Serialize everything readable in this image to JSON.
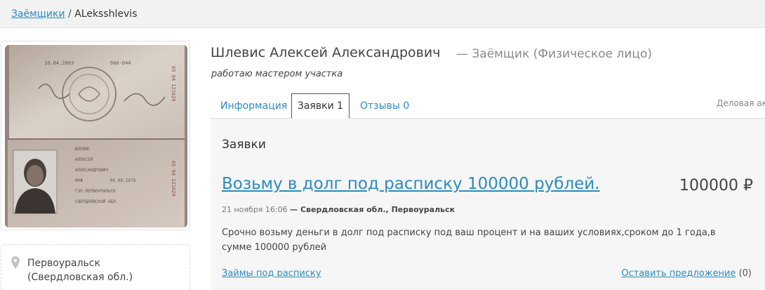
{
  "breadcrumb": {
    "parent_label": "Заёмщики",
    "separator": "/",
    "current": "ALeksshlevis"
  },
  "location": {
    "city": "Первоуральск",
    "region": "(Свердловская обл.)"
  },
  "profile": {
    "name": "Шлевис Алексей Александрович",
    "role": "— Заёмщик (Физическое лицо)",
    "about": "работаю мастером участка"
  },
  "tabs": [
    {
      "label": "Информация",
      "active": false
    },
    {
      "label": "Заявки 1",
      "active": true
    },
    {
      "label": "Отзывы 0",
      "active": false
    }
  ],
  "tab_business_partial": "Деловая акт",
  "requests": {
    "title": "Заявки",
    "items": [
      {
        "title": "Возьму в долг под расписку 100000 рублей.",
        "amount": "100000 ₽",
        "date": "21 ноября 16:06",
        "location": "— Свердловская обл., Первоуральск",
        "description": "Срочно возьму деньги в долг под расписку под ваш процент и на ваших условиях,сроком до 1 года,в сумме 100000 рублей",
        "category": "Займы под расписку",
        "offer_label": "Оставить предложение",
        "offer_count": "(0)"
      }
    ]
  },
  "photo": {
    "issue_date": "10.04.2003",
    "issue_code": "660-044",
    "series_top": "65 04 121629",
    "series_bottom": "65 04 121629",
    "surname": "ШЛЕВИС",
    "first_name": "АЛЕКСЕЙ",
    "patronymic": "АЛЕКСАНДРОВИЧ",
    "sex": "МУЖ",
    "birth_date": "05.09.1979",
    "birth_place_1": "ГОР.ПЕРВОУРАЛЬСК",
    "birth_place_2": "СВЕРДЛОВСКОЙ ОБЛ."
  },
  "colors": {
    "link": "#2b8bbd",
    "panel_bg": "#f6f6f6",
    "bar_bg": "#f2f2f2"
  },
  "icons": {
    "location": "map-pin-icon"
  }
}
